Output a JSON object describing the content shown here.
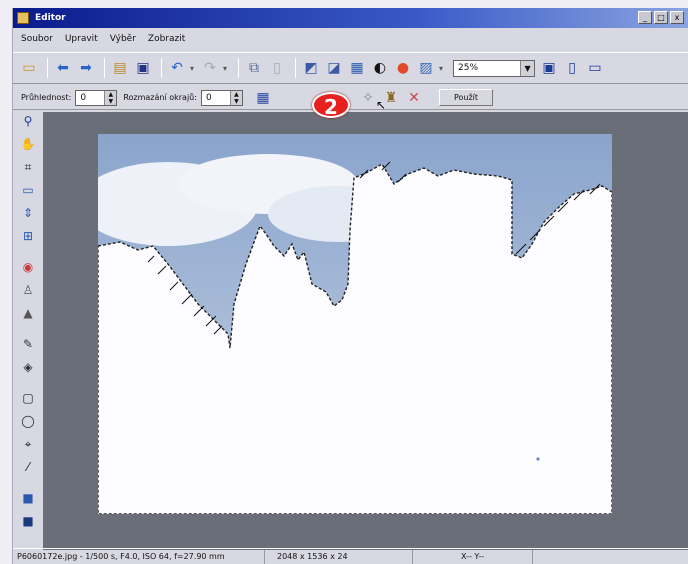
{
  "window": {
    "title": "Editor",
    "controls": [
      "_",
      "□",
      "x"
    ]
  },
  "menu": [
    "Soubor",
    "Upravit",
    "Výběr",
    "Zobrazit"
  ],
  "toolbar": {
    "zoom_value": "25%"
  },
  "options_bar": {
    "tolerance_label": "Průhlednost:",
    "tolerance_value": "0",
    "feather_label": "Rozmazání okrajů:",
    "feather_value": "0",
    "apply_label": "Použít"
  },
  "callout": "2",
  "status": {
    "file_info": "P6060172e.jpg - 1/500 s, F4.0, ISO 64, f=27.90 mm",
    "dimensions": "2048 x 1536 x 24",
    "coords": "X-- Y--"
  },
  "colors": {
    "title_start": "#0a1a8c",
    "workspace": "#6a6e78",
    "callout": "#e82020",
    "sky": "#a8bcd8"
  }
}
